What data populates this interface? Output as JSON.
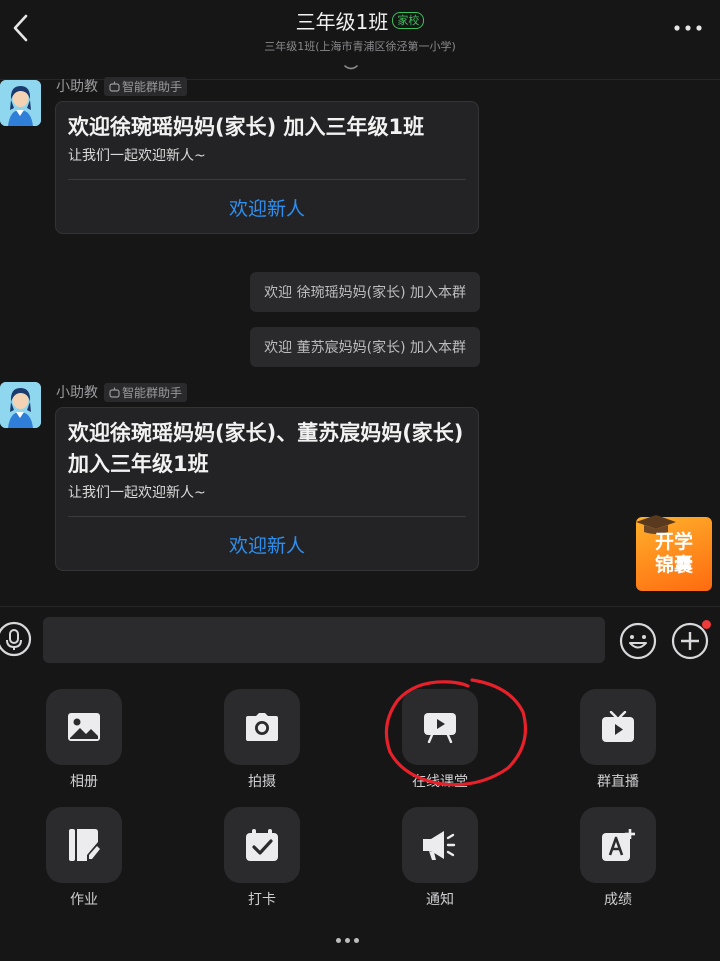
{
  "header": {
    "title": "三年级1班",
    "tag": "家校",
    "subtitle": "三年级1班(上海市青浦区徐泾第一小学)"
  },
  "messages": [
    {
      "sender": "小助教",
      "badge": "智能群助手",
      "card_title": "欢迎徐琬瑶妈妈(家长) 加入三年级1班",
      "card_sub": "让我们一起欢迎新人~",
      "card_action": "欢迎新人"
    },
    {
      "sender": "小助教",
      "badge": "智能群助手",
      "card_title": "欢迎徐琬瑶妈妈(家长)、董苏宸妈妈(家长) 加入三年级1班",
      "card_sub": "让我们一起欢迎新人~",
      "card_action": "欢迎新人"
    }
  ],
  "system_messages": [
    "欢迎 徐琬瑶妈妈(家长) 加入本群",
    "欢迎 董苏宸妈妈(家长) 加入本群"
  ],
  "promo": {
    "line1": "开学",
    "line2": "锦囊"
  },
  "input": {
    "value": "",
    "placeholder": ""
  },
  "tools": [
    {
      "label": "相册",
      "icon": "photo-icon"
    },
    {
      "label": "拍摄",
      "icon": "camera-icon"
    },
    {
      "label": "在线课堂",
      "icon": "online-class-icon"
    },
    {
      "label": "群直播",
      "icon": "live-tv-icon"
    },
    {
      "label": "作业",
      "icon": "homework-icon"
    },
    {
      "label": "打卡",
      "icon": "checkin-icon"
    },
    {
      "label": "通知",
      "icon": "megaphone-icon"
    },
    {
      "label": "成绩",
      "icon": "grades-icon"
    }
  ],
  "colors": {
    "background": "#161617",
    "accent": "#2d8ff0",
    "tag_green": "#3fbf5b",
    "annotation_red": "#e8202a"
  }
}
